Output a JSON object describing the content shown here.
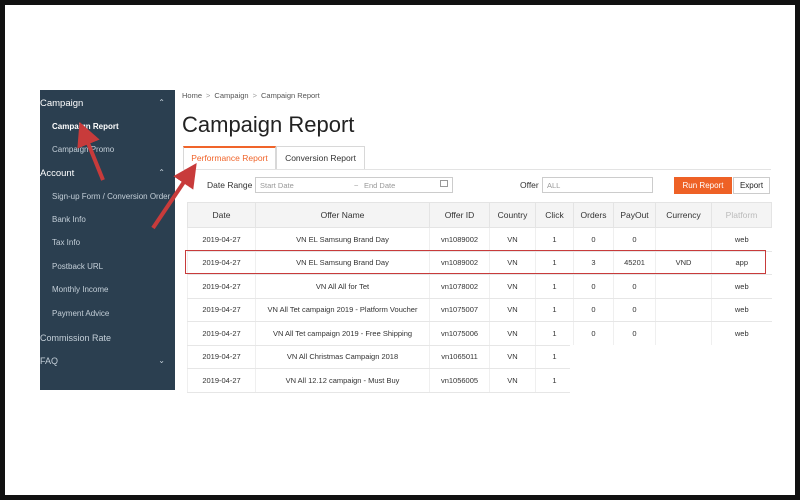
{
  "sidebar": {
    "campaign_label": "Campaign",
    "campaign_items": [
      "Campaign Report",
      "Campaign Promo"
    ],
    "account_label": "Account",
    "account_items": [
      "Sign-up Form / Conversion Order",
      "Bank Info",
      "Tax Info",
      "Postback URL",
      "Monthly Income",
      "Payment Advice"
    ],
    "commission_label": "Commission Rate",
    "faq_label": "FAQ"
  },
  "breadcrumb": [
    "Home",
    "Campaign",
    "Campaign Report"
  ],
  "page_title": "Campaign Report",
  "tabs": [
    {
      "label": "Performance Report",
      "active": true
    },
    {
      "label": "Conversion Report",
      "active": false
    }
  ],
  "filters": {
    "date_range_label": "Date Range",
    "start_placeholder": "Start Date",
    "range_separator": "~",
    "end_placeholder": "End Date",
    "offer_label": "Offer",
    "offer_placeholder": "ALL",
    "run_button": "Run Report",
    "export_button": "Export"
  },
  "table": {
    "columns": [
      "Date",
      "Offer Name",
      "Offer ID",
      "Country",
      "Click",
      "Orders",
      "PayOut",
      "Currency",
      "Platform"
    ],
    "rows": [
      [
        "2019-04-27",
        "VN EL Samsung Brand Day",
        "vn1089002",
        "VN",
        "1",
        "0",
        "0",
        "",
        "web"
      ],
      [
        "2019-04-27",
        "VN EL Samsung Brand Day",
        "vn1089002",
        "VN",
        "1",
        "3",
        "45201",
        "VND",
        "app"
      ],
      [
        "2019-04-27",
        "VN All All for Tet",
        "vn1078002",
        "VN",
        "1",
        "0",
        "0",
        "",
        "web"
      ],
      [
        "2019-04-27",
        "VN All Tet campaign 2019 - Platform Voucher",
        "vn1075007",
        "VN",
        "1",
        "0",
        "0",
        "",
        "web"
      ],
      [
        "2019-04-27",
        "VN All Tet campaign 2019 - Free Shipping",
        "vn1075006",
        "VN",
        "1",
        "0",
        "0",
        "",
        "web"
      ],
      [
        "2019-04-27",
        "VN All Christmas Campaign 2018",
        "vn1065011",
        "VN",
        "1",
        "",
        "",
        "",
        ""
      ],
      [
        "2019-04-27",
        "VN All 12.12 campaign - Must Buy",
        "vn1056005",
        "VN",
        "1",
        "",
        "",
        "",
        ""
      ]
    ],
    "highlighted_row": 1
  },
  "colors": {
    "sidebar_bg": "#2b3f50",
    "accent": "#ee6126",
    "annotation": "#c83b3b"
  }
}
